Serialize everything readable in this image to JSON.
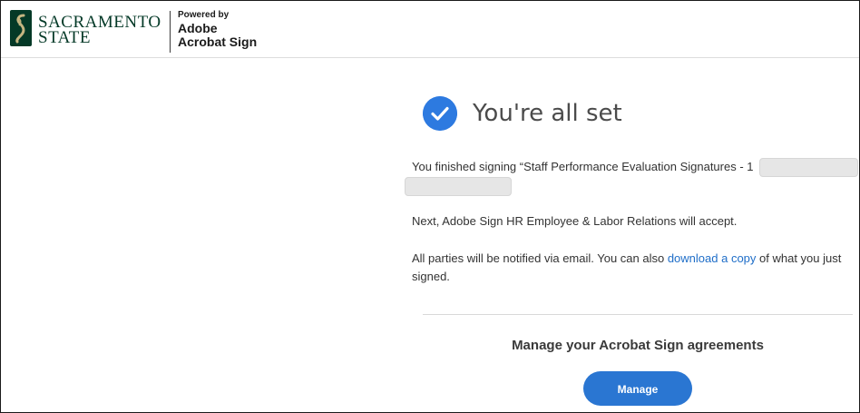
{
  "header": {
    "org_name_line1": "SACRAMENTO",
    "org_name_line2": "STATE",
    "powered_by": "Powered by",
    "product_line1": "Adobe",
    "product_line2": "Acrobat Sign"
  },
  "status": {
    "icon": "check-circle-icon",
    "title": "You're all set",
    "finished_prefix": "You finished signing “Staff Performance Evaluation Signatures - 1",
    "next_step": "Next, Adobe Sign HR Employee & Labor Relations will accept.",
    "notify_prefix": "All parties will be notified via email. You can also ",
    "download_link": "download a copy",
    "notify_suffix": " of what you just",
    "notify_line2": "signed."
  },
  "manage": {
    "heading": "Manage your Acrobat Sign agreements",
    "button_label": "Manage"
  },
  "colors": {
    "accent": "#2a76d2",
    "brand_green": "#043927",
    "link": "#1f6ec8"
  }
}
